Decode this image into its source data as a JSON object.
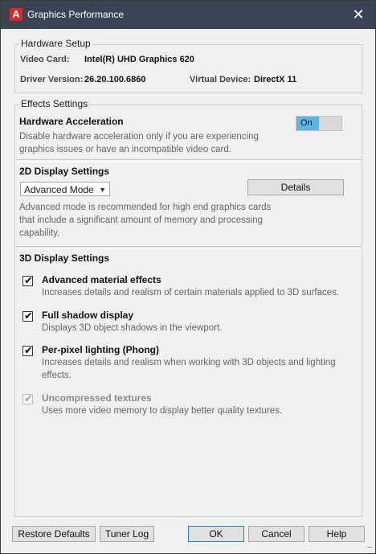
{
  "window": {
    "title": "Graphics Performance",
    "app_icon_letter": "A",
    "close_glyph": "✕"
  },
  "hardware": {
    "group_title": "Hardware Setup",
    "video_card_label": "Video Card:",
    "video_card_value": "Intel(R) UHD Graphics 620",
    "driver_label": "Driver Version:",
    "driver_value": "26.20.100.6860",
    "virtual_device_label": "Virtual Device:",
    "virtual_device_value": "DirectX 11"
  },
  "effects": {
    "group_title": "Effects Settings",
    "hw_accel": {
      "title": "Hardware Acceleration",
      "desc1": "Disable hardware acceleration only if you are experiencing",
      "desc2": "graphics issues or have an incompatible video card.",
      "toggle_label": "On"
    },
    "display2d": {
      "title": "2D Display Settings",
      "mode": "Advanced Mode",
      "details_button": "Details",
      "desc1": "Advanced mode is recommended for high end graphics cards",
      "desc2": "that include a significant amount of memory and processing",
      "desc3": "capability."
    },
    "display3d": {
      "title": "3D Display Settings",
      "options": [
        {
          "title": "Advanced material effects",
          "desc1": "Increases details and realism of certain materials applied to 3D surfaces.",
          "desc2": "",
          "checked": true,
          "enabled": true
        },
        {
          "title": "Full shadow display",
          "desc1": "Displays 3D object shadows in the viewport.",
          "desc2": "",
          "checked": true,
          "enabled": true
        },
        {
          "title": "Per-pixel lighting (Phong)",
          "desc1": "Increases details and realism when working with 3D objects and lighting",
          "desc2": "effects.",
          "checked": true,
          "enabled": true
        },
        {
          "title": "Uncompressed textures",
          "desc1": "Uses more video memory to display better quality textures.",
          "desc2": "",
          "checked": true,
          "enabled": false
        }
      ]
    }
  },
  "footer": {
    "restore_defaults": "Restore Defaults",
    "tuner_log": "Tuner Log",
    "ok": "OK",
    "cancel": "Cancel",
    "help": "Help"
  },
  "colors": {
    "titlebar": "#3b4453",
    "toggle_on": "#5db5e6",
    "background": "#f0f0f0"
  },
  "icons": {
    "check": "✔"
  }
}
